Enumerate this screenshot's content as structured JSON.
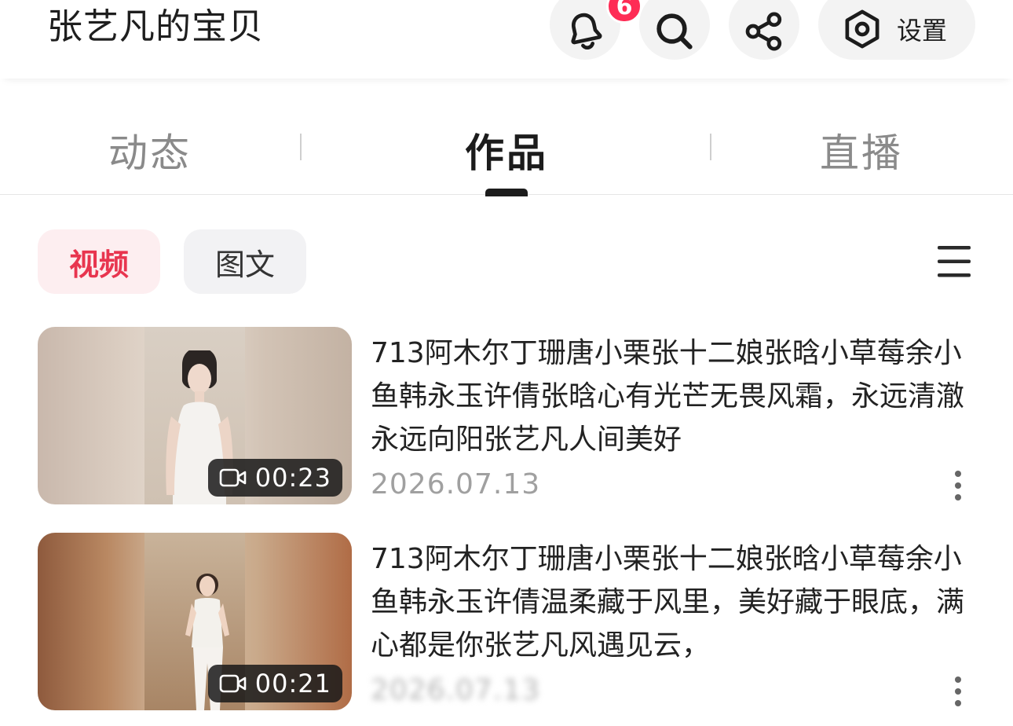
{
  "header": {
    "title": "张艺凡的宝贝",
    "notification_count": "6",
    "settings_label": "设置",
    "icons": [
      "bell-icon",
      "search-icon",
      "share-icon",
      "settings-hex-icon"
    ],
    "badge_color": "#fe2c55"
  },
  "tabs": {
    "items": [
      {
        "label": "动态",
        "active": false
      },
      {
        "label": "作品",
        "active": true
      },
      {
        "label": "直播",
        "active": false
      }
    ]
  },
  "filters": {
    "video": "视频",
    "graphic": "图文",
    "active_color": "#e8354f",
    "menu_icon": "hamburger-icon"
  },
  "videos": [
    {
      "duration": "00:23",
      "title": "713阿木尔丁珊唐小栗张十二娘张晗小草莓余小鱼韩永玉许倩张晗心有光芒无畏风霜，永远清澈永远向阳张艺凡人间美好",
      "date": "2026.07.13"
    },
    {
      "duration": "00:21",
      "title": "713阿木尔丁珊唐小栗张十二娘张晗小草莓余小鱼韩永玉许倩温柔藏于风里，美好藏于眼底，满心都是你张艺凡风遇见云，",
      "date": "2026.07.13"
    }
  ]
}
